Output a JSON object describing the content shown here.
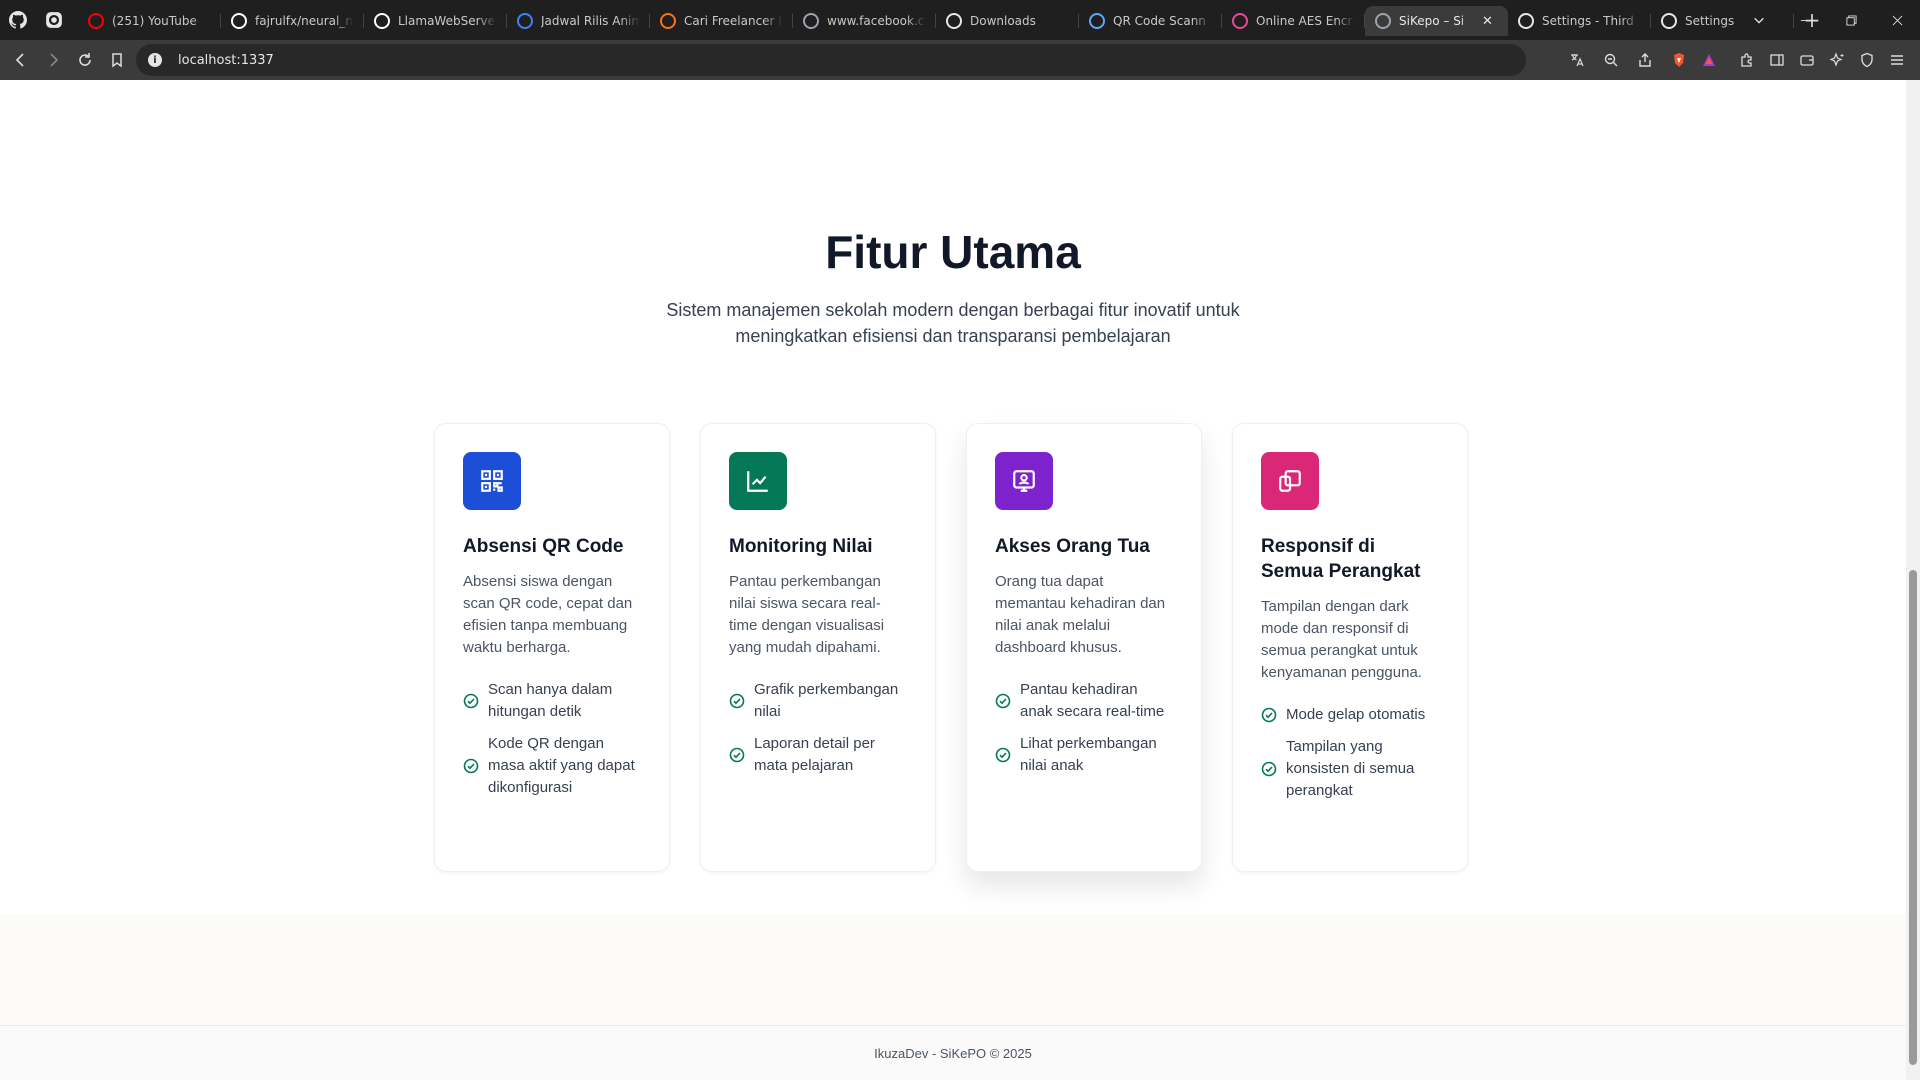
{
  "browser": {
    "tabs": [
      {
        "title": "(251) YouTube",
        "favicon": "youtube-icon",
        "color": "#ff0000"
      },
      {
        "title": "fajrulfx/neural_n",
        "favicon": "github-icon",
        "color": "#ffffff"
      },
      {
        "title": "LlamaWebServer",
        "favicon": "github-icon",
        "color": "#ffffff"
      },
      {
        "title": "Jadwal Rilis Anim",
        "favicon": "bookmark-icon",
        "color": "#3b82f6"
      },
      {
        "title": "Cari Freelancer I",
        "favicon": "freelancer-icon",
        "color": "#f97316"
      },
      {
        "title": "www.facebook.c",
        "favicon": "facebook-icon",
        "color": "#9ca3af"
      },
      {
        "title": "Downloads",
        "favicon": "download-icon",
        "color": "#e5e7eb"
      },
      {
        "title": "QR Code Scann",
        "favicon": "qr-icon",
        "color": "#60a5fa"
      },
      {
        "title": "Online AES Encr",
        "favicon": "aes-icon",
        "color": "#ec4899"
      },
      {
        "title": "SiKepo – Si",
        "favicon": "sikepo-icon",
        "color": "#9ca3af"
      },
      {
        "title": "Settings - Third",
        "favicon": "gear-icon",
        "color": "#e5e7eb"
      },
      {
        "title": "Settings",
        "favicon": "gear-icon",
        "color": "#e5e7eb"
      }
    ],
    "active_tab_index": 9,
    "url": "localhost:1337"
  },
  "features": {
    "title": "Fitur Utama",
    "subtitle": "Sistem manajemen sekolah modern dengan berbagai fitur inovatif untuk meningkatkan efisiensi dan transparansi pembelajaran",
    "cards": [
      {
        "title": "Absensi QR Code",
        "description": "Absensi siswa dengan scan QR code, cepat dan efisien tanpa membuang waktu berharga.",
        "icon": "qr-code-icon",
        "color": "#1d4ed8",
        "bullets": [
          "Scan hanya dalam hitungan detik",
          "Kode QR dengan masa aktif yang dapat dikonfigurasi"
        ]
      },
      {
        "title": "Monitoring Nilai",
        "description": "Pantau perkembangan nilai siswa secara real-time dengan visualisasi yang mudah dipahami.",
        "icon": "line-chart-icon",
        "color": "#047857",
        "bullets": [
          "Grafik perkembangan nilai",
          "Laporan detail per mata pelajaran"
        ]
      },
      {
        "title": "Akses Orang Tua",
        "description": "Orang tua dapat memantau kehadiran dan nilai anak melalui dashboard khusus.",
        "icon": "user-board-icon",
        "color": "#7e22ce",
        "bullets": [
          "Pantau kehadiran anak secara real-time",
          "Lihat perkembangan nilai anak"
        ]
      },
      {
        "title": "Responsif di Semua Perangkat",
        "description": "Tampilan dengan dark mode dan responsif di semua perangkat untuk kenyamanan pengguna.",
        "icon": "devices-icon",
        "color": "#db2777",
        "bullets": [
          "Mode gelap otomatis",
          "Tampilan yang konsisten di semua perangkat"
        ]
      }
    ],
    "check_color": "#047857"
  },
  "footer": {
    "text": "IkuzaDev - SiKePO © 2025"
  }
}
